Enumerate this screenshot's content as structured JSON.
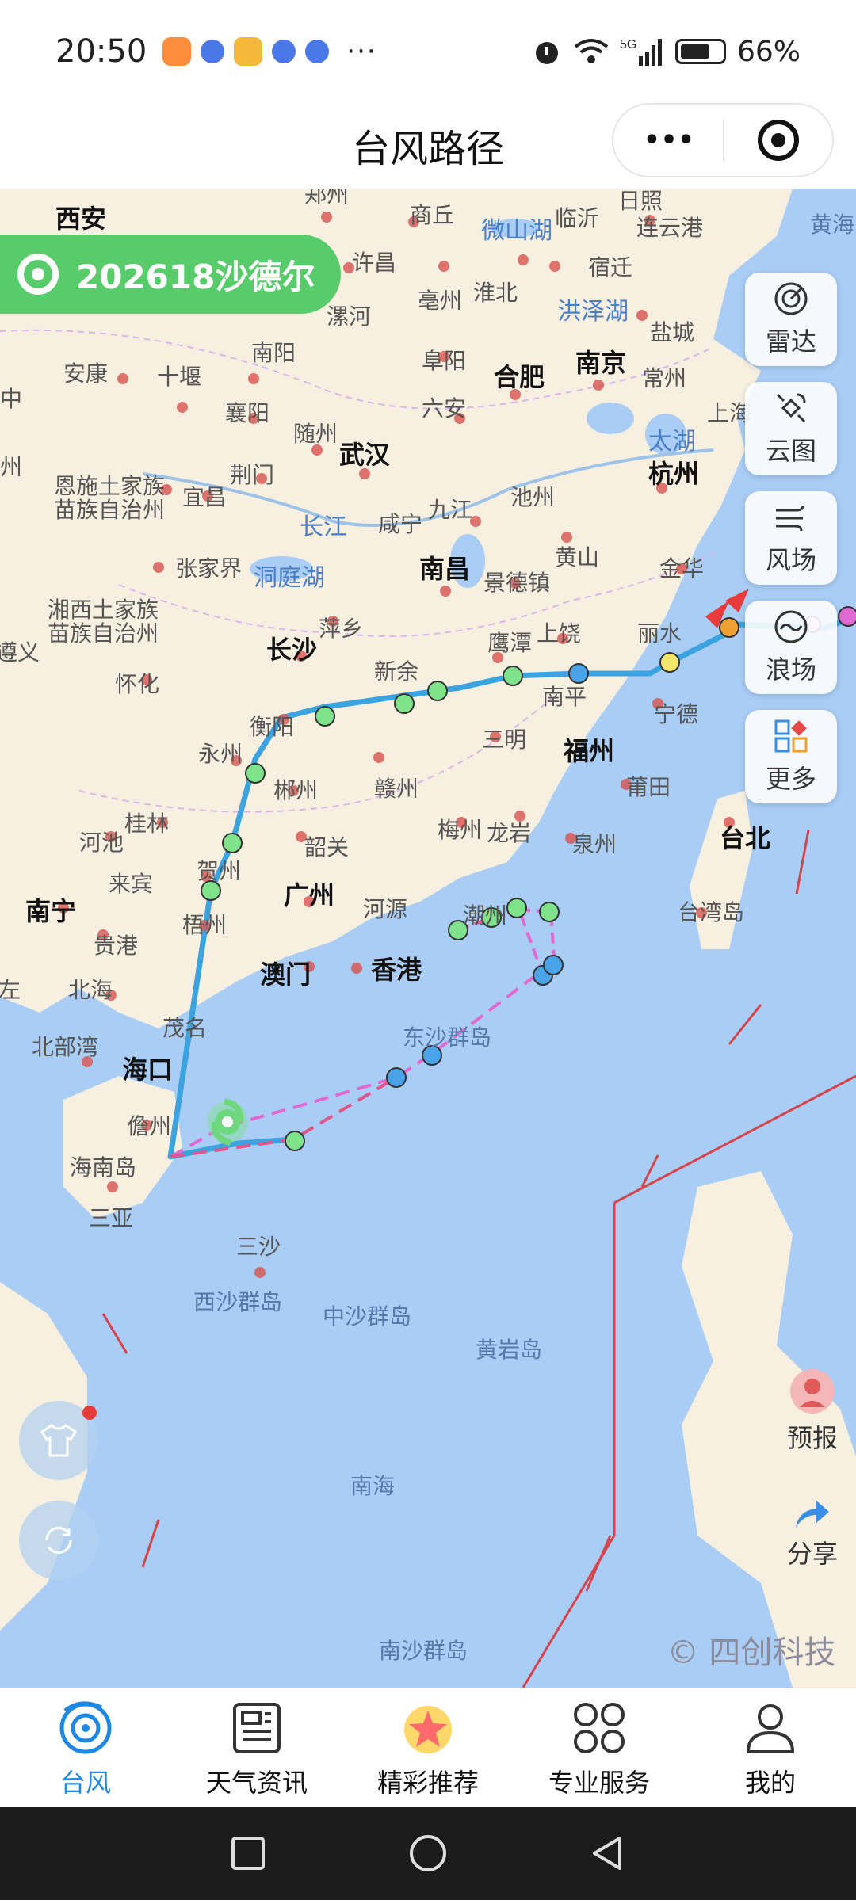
{
  "status_bar": {
    "time": "20:50",
    "more": "···",
    "battery": "66%"
  },
  "header": {
    "title": "台风路径",
    "menu": "•••"
  },
  "storm": {
    "name": "202618沙德尔"
  },
  "tools": [
    {
      "label": "雷达",
      "icon": "radar-icon"
    },
    {
      "label": "云图",
      "icon": "satellite-icon"
    },
    {
      "label": "风场",
      "icon": "wind-icon"
    },
    {
      "label": "浪场",
      "icon": "wave-icon"
    },
    {
      "label": "更多",
      "icon": "grid-icon"
    }
  ],
  "side_buttons": {
    "forecast": "预报",
    "share": "分享"
  },
  "map": {
    "copyright": "© 四创科技",
    "places": [
      "西安",
      "郑州",
      "商丘",
      "临沂",
      "日照",
      "连云港",
      "黄海",
      "许昌",
      "微山湖",
      "宿迁",
      "亳州",
      "淮北",
      "洪泽湖",
      "漯河",
      "盐城",
      "南阳",
      "阜阳",
      "合肥",
      "南京",
      "常州",
      "安康",
      "十堰",
      "襄阳",
      "六安",
      "上海",
      "随州",
      "武汉",
      "太湖",
      "杭州",
      "荆门",
      "恩施土家族",
      "苗族自治州",
      "宜昌",
      "池州",
      "长江",
      "咸宁",
      "九江",
      "黄山",
      "张家界",
      "洞庭湖",
      "南昌",
      "景德镇",
      "金华",
      "湘西土家族",
      "苗族自治州",
      "萍乡",
      "鹰潭",
      "上饶",
      "丽水",
      "长沙",
      "新余",
      "南平",
      "怀化",
      "三明",
      "宁德",
      "衡阳",
      "福州",
      "永州",
      "赣州",
      "莆田",
      "郴州",
      "桂林",
      "梅州",
      "龙岩",
      "泉州",
      "台北",
      "河池",
      "韶关",
      "贺州",
      "来宾",
      "广州",
      "河源",
      "潮州",
      "台湾岛",
      "南宁",
      "贵港",
      "梧州",
      "澳门",
      "香港",
      "北海",
      "茂名",
      "东沙群岛",
      "北部湾",
      "海口",
      "儋州",
      "海南岛",
      "三亚",
      "三沙",
      "西沙群岛",
      "中沙群岛",
      "黄岩岛",
      "南海",
      "南沙群岛",
      "遵义",
      "左",
      "中",
      "州"
    ]
  },
  "tabs": [
    {
      "label": "台风",
      "icon": "typhoon-icon",
      "active": true
    },
    {
      "label": "天气资讯",
      "icon": "news-icon",
      "active": false
    },
    {
      "label": "精彩推荐",
      "icon": "star-icon",
      "active": false
    },
    {
      "label": "专业服务",
      "icon": "service-icon",
      "active": false
    },
    {
      "label": "我的",
      "icon": "profile-icon",
      "active": false
    }
  ],
  "colors": {
    "sea": "#a9cdf5",
    "land": "#f7f0e1",
    "track": "#3aa3e0",
    "forecast": "#e06ad2",
    "chip": "#58cc6a"
  }
}
